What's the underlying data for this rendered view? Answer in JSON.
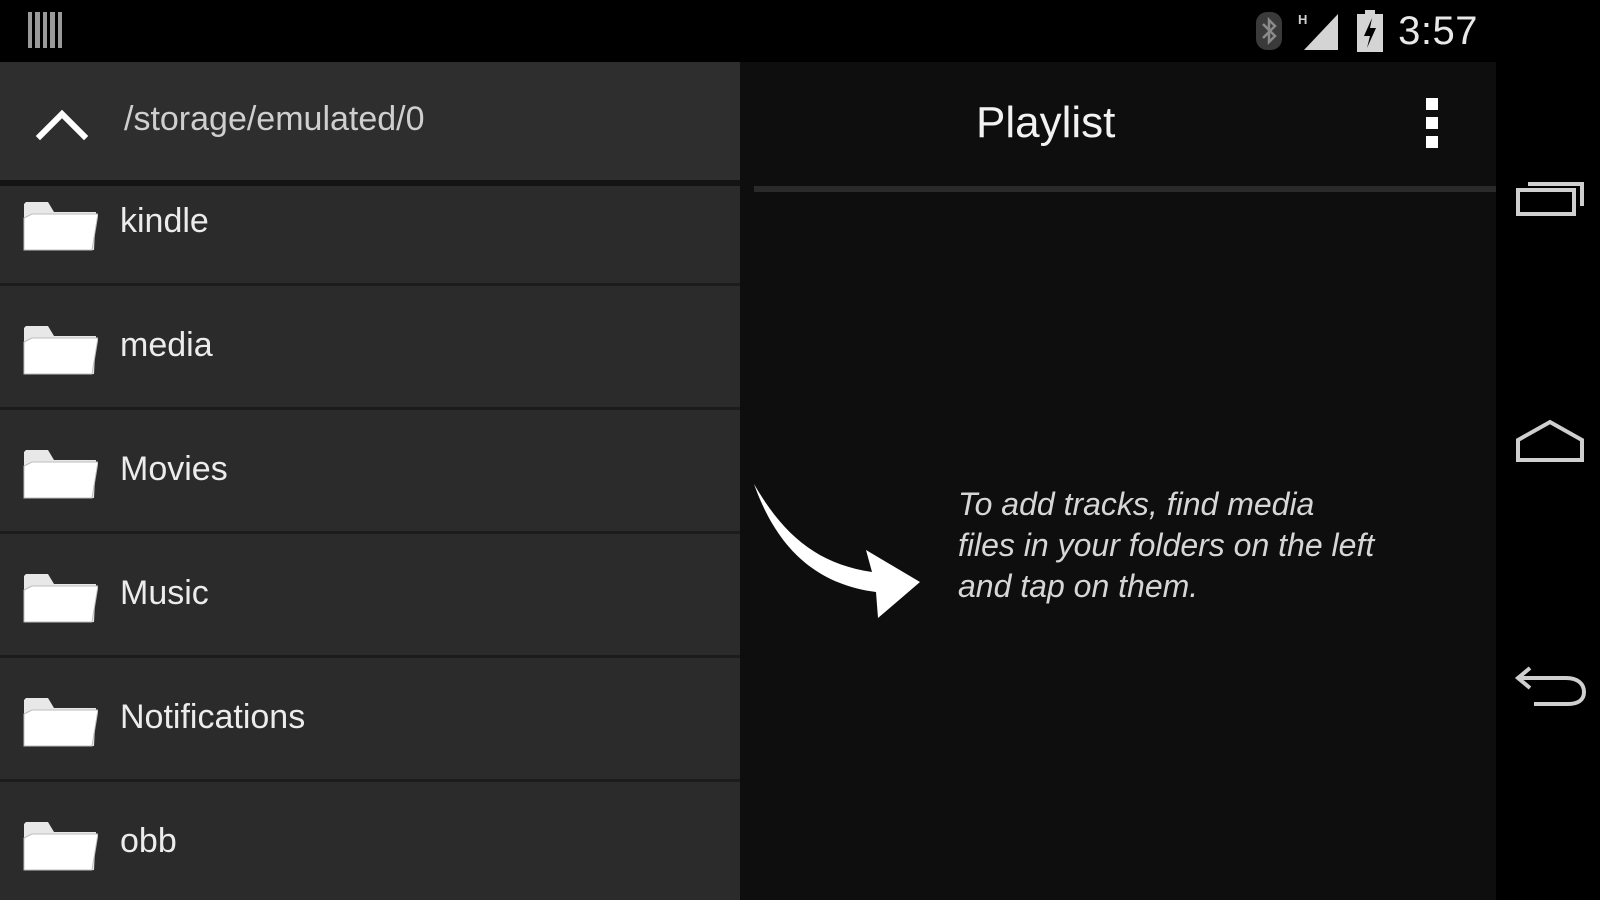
{
  "status_bar": {
    "time": "3:57",
    "icons": [
      "notification-bars-icon",
      "bluetooth-icon",
      "hspa-signal-icon",
      "battery-charging-icon"
    ]
  },
  "browser": {
    "path": "/storage/emulated/0",
    "up_icon": "chevron-up-icon",
    "folders": [
      {
        "label": "kindle"
      },
      {
        "label": "media"
      },
      {
        "label": "Movies"
      },
      {
        "label": "Music"
      },
      {
        "label": "Notifications"
      },
      {
        "label": "obb"
      }
    ]
  },
  "playlist": {
    "title": "Playlist",
    "menu_icon": "overflow-menu-icon",
    "hint": "To add tracks, find media files in your folders on the left and tap on them."
  },
  "nav_bar": {
    "buttons": [
      "recent-apps-icon",
      "home-icon",
      "back-icon"
    ]
  },
  "colors": {
    "left_pane_bg": "#2b2b2b",
    "right_pane_bg": "#0e0e0e",
    "text_primary": "#ececec"
  }
}
